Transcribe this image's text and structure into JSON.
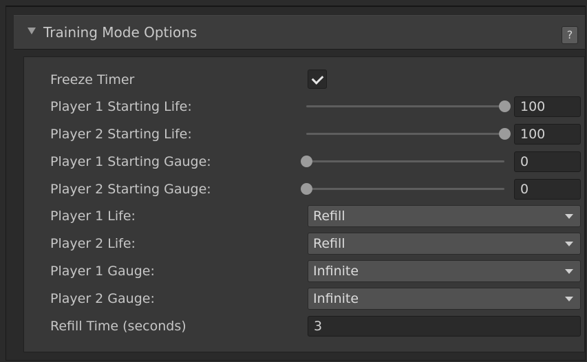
{
  "header": {
    "title": "Training Mode Options",
    "help_label": "?",
    "foldout_icon": "triangle-down-icon"
  },
  "fields": {
    "freeze_timer": {
      "label": "Freeze Timer",
      "checked": true
    },
    "p1_start_life": {
      "label": "Player 1 Starting Life:",
      "value": "100",
      "slider_fraction": 1.0
    },
    "p2_start_life": {
      "label": "Player 2 Starting Life:",
      "value": "100",
      "slider_fraction": 1.0
    },
    "p1_start_gauge": {
      "label": "Player 1 Starting Gauge:",
      "value": "0",
      "slider_fraction": 0.0
    },
    "p2_start_gauge": {
      "label": "Player 2 Starting Gauge:",
      "value": "0",
      "slider_fraction": 0.0
    },
    "p1_life": {
      "label": "Player 1 Life:",
      "value": "Refill"
    },
    "p2_life": {
      "label": "Player 2 Life:",
      "value": "Refill"
    },
    "p1_gauge": {
      "label": "Player 1 Gauge:",
      "value": "Infinite"
    },
    "p2_gauge": {
      "label": "Player 2 Gauge:",
      "value": "Infinite"
    },
    "refill_time": {
      "label": "Refill Time (seconds)",
      "value": "3"
    }
  },
  "colors": {
    "background": "#2b2b2b",
    "header": "#3c3c3c",
    "panel": "#383838",
    "dropdown": "#515151",
    "field": "#2a2a2a",
    "thumb": "#9b9b9b",
    "text": "#c6c6c6"
  }
}
